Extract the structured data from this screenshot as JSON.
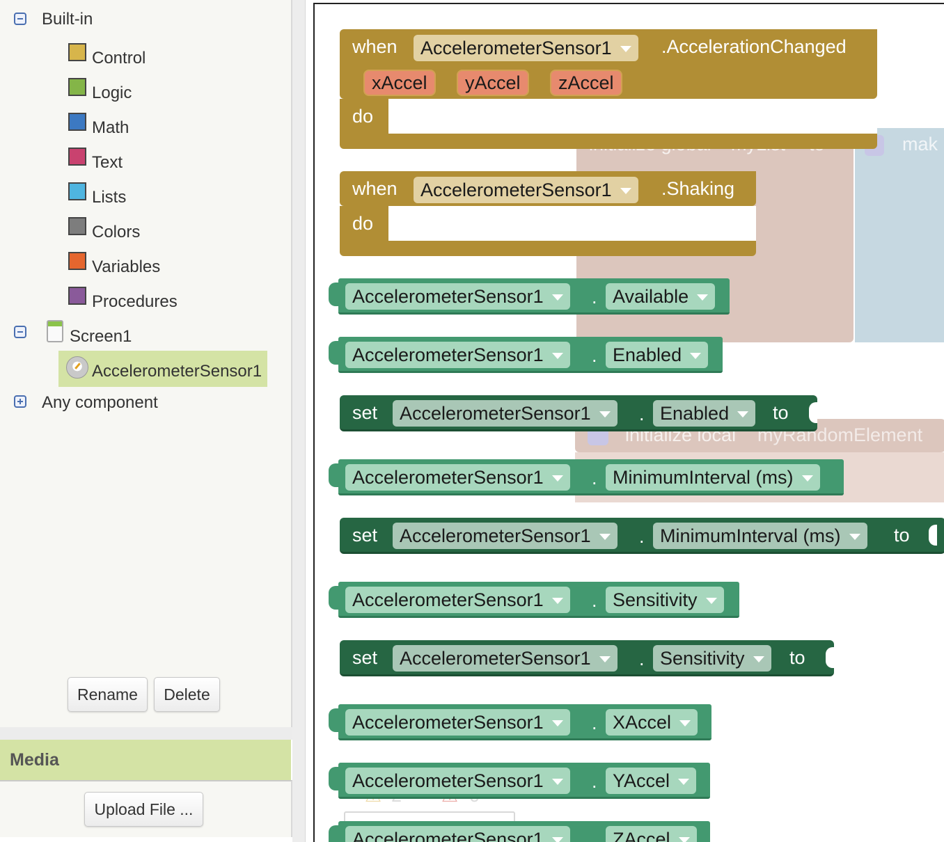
{
  "tree": {
    "builtin_label": "Built-in",
    "categories": [
      {
        "label": "Control",
        "color": "#d7b54b"
      },
      {
        "label": "Logic",
        "color": "#84b548"
      },
      {
        "label": "Math",
        "color": "#3c79c2"
      },
      {
        "label": "Text",
        "color": "#c9426f"
      },
      {
        "label": "Lists",
        "color": "#4fb5e0"
      },
      {
        "label": "Colors",
        "color": "#7d7d7d"
      },
      {
        "label": "Variables",
        "color": "#e5662e"
      },
      {
        "label": "Procedures",
        "color": "#8a5a9a"
      }
    ],
    "screen_label": "Screen1",
    "component_label": "AccelerometerSensor1",
    "any_component_label": "Any component"
  },
  "buttons": {
    "rename": "Rename",
    "delete": "Delete",
    "upload": "Upload File ..."
  },
  "media": {
    "title": "Media"
  },
  "workspace": {
    "ghost": {
      "init_global": "initialize global",
      "mylist": "myList",
      "to": "to",
      "make": "mak",
      "init_local": "initialize local",
      "random_element": "myRandomElement",
      "warn_count": "2",
      "error_count": "0"
    },
    "event1": {
      "when": "when",
      "component": "AccelerometerSensor1",
      "event": ".AccelerationChanged",
      "params": [
        "xAccel",
        "yAccel",
        "zAccel"
      ],
      "do": "do"
    },
    "event2": {
      "when": "when",
      "component": "AccelerometerSensor1",
      "event": ".Shaking",
      "do": "do"
    },
    "getters": [
      {
        "component": "AccelerometerSensor1",
        "property": "Available"
      },
      {
        "component": "AccelerometerSensor1",
        "property": "Enabled"
      },
      {
        "component": "AccelerometerSensor1",
        "property": "MinimumInterval (ms)"
      },
      {
        "component": "AccelerometerSensor1",
        "property": "Sensitivity"
      },
      {
        "component": "AccelerometerSensor1",
        "property": "XAccel"
      },
      {
        "component": "AccelerometerSensor1",
        "property": "YAccel"
      },
      {
        "component": "AccelerometerSensor1",
        "property": "ZAccel"
      }
    ],
    "setters": [
      {
        "set": "set",
        "component": "AccelerometerSensor1",
        "property": "Enabled",
        "to": "to"
      },
      {
        "set": "set",
        "component": "AccelerometerSensor1",
        "property": "MinimumInterval (ms)",
        "to": "to"
      },
      {
        "set": "set",
        "component": "AccelerometerSensor1",
        "property": "Sensitivity",
        "to": "to"
      }
    ],
    "dot": "."
  }
}
